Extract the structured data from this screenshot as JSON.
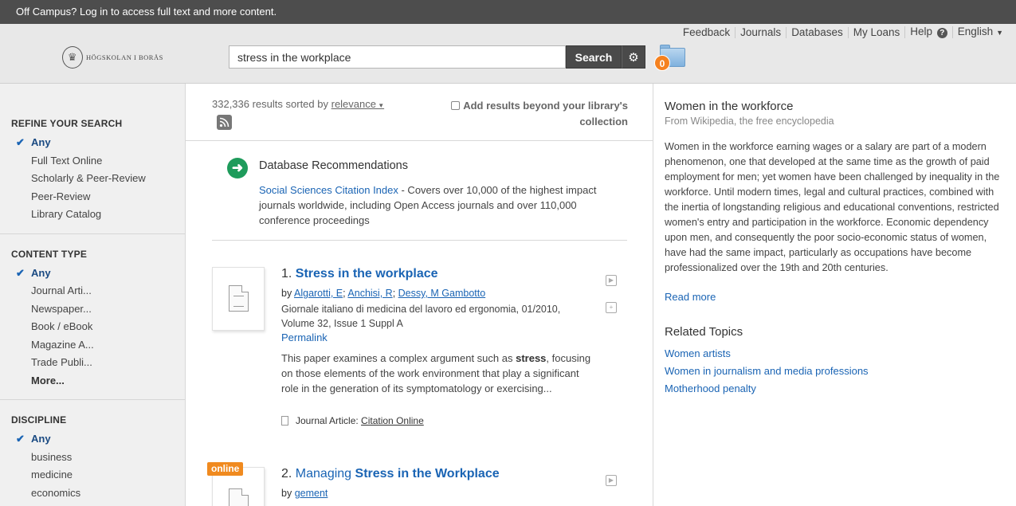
{
  "topbar": {
    "message": "Off Campus? Log in to access full text and more content."
  },
  "header": {
    "logo_text": "HÖGSKOLAN I BORÅS",
    "search_value": "stress in the workplace",
    "search_button": "Search",
    "folder_count": "0",
    "nav": [
      "Feedback",
      "Journals",
      "Databases",
      "My Loans",
      "Help",
      "English"
    ]
  },
  "sidebar": {
    "refine": {
      "title": "REFINE YOUR SEARCH",
      "items": [
        "Any",
        "Full Text Online",
        "Scholarly & Peer-Review",
        "Peer-Review",
        "Library Catalog"
      ]
    },
    "content_type": {
      "title": "CONTENT TYPE",
      "items": [
        "Any",
        "Journal Arti...",
        "Newspaper...",
        "Book / eBook",
        "Magazine A...",
        "Trade Publi...",
        "More..."
      ]
    },
    "discipline": {
      "title": "DISCIPLINE",
      "items": [
        "Any",
        "business",
        "medicine",
        "economics"
      ]
    }
  },
  "results": {
    "count": "332,336 results sorted by",
    "sort": "relevance",
    "beyond": "Add results beyond your library's collection",
    "dbrec": {
      "title": "Database Recommendations",
      "link": "Social Sciences Citation Index",
      "text": " - Covers over 10,000 of the highest impact journals worldwide, including Open Access journals and over 110,000 conference proceedings"
    },
    "r1": {
      "num": "1.",
      "title": "Stress in the workplace",
      "by": "by",
      "authors": [
        "Algarotti, E",
        "Anchisi, R",
        "Dessy, M Gambotto"
      ],
      "pub": "Giornale italiano di medicina del lavoro ed ergonomia, 01/2010, Volume 32, Issue 1 Suppl A",
      "permalink": "Permalink",
      "snippet_pre": "This paper examines a complex argument such as ",
      "snippet_bold": "stress",
      "snippet_post": ", focusing on those elements of the work environment that play a significant role in the generation of its symptomatology or exercising...",
      "type": "Journal Article:",
      "fulltext": "Citation Online"
    },
    "r2": {
      "badge": "online",
      "num": "2.",
      "title_pre": "Managing ",
      "title_bold": "Stress in the Workplace",
      "by": "by",
      "author": "gement"
    }
  },
  "right": {
    "title": "Women in the workforce",
    "source": "From Wikipedia, the free encyclopedia",
    "body": "Women in the workforce earning wages or a salary are part of a modern phenomenon, one that developed at the same time as the growth of paid employment for men; yet women have been challenged by inequality in the workforce. Until modern times, legal and cultural practices, combined with the inertia of longstanding religious and educational conventions, restricted women's entry and participation in the workforce. Economic dependency upon men, and consequently the poor socio-economic status of women, have had the same impact, particularly as occupations have become professionalized over the 19th and 20th centuries.",
    "read_more": "Read more",
    "related_title": "Related Topics",
    "related": [
      "Women artists",
      "Women in journalism and media professions",
      "Motherhood penalty"
    ]
  }
}
